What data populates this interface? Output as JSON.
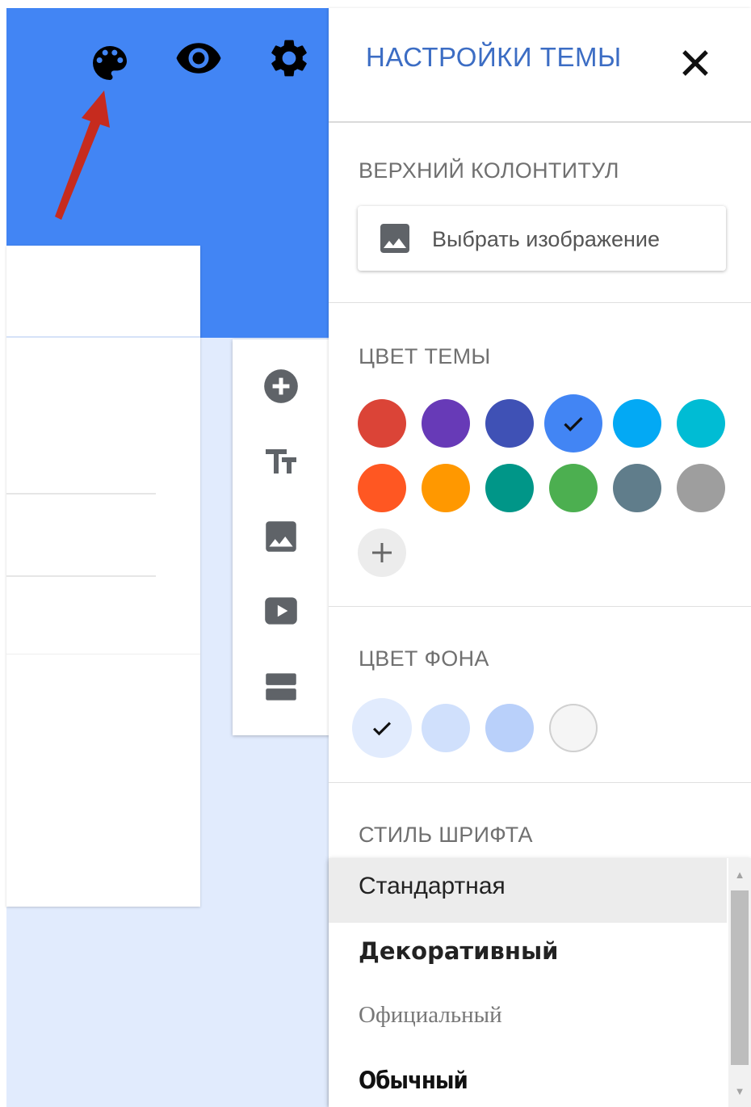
{
  "header": {
    "icons": [
      "palette-icon",
      "eye-icon",
      "gear-icon"
    ],
    "color": "#4285f4"
  },
  "toolbar": {
    "icons": [
      "add-circle-icon",
      "text-title-icon",
      "image-icon",
      "video-icon",
      "section-icon"
    ]
  },
  "panel": {
    "title": "НАСТРОЙКИ ТЕМЫ",
    "header_section": {
      "label": "ВЕРХНИЙ КОЛОНТИТУЛ",
      "button_label": "Выбрать изображение"
    },
    "theme_color": {
      "label": "ЦВЕТ ТЕМЫ",
      "colors": [
        "#db4437",
        "#673ab7",
        "#3f51b5",
        "#4285f4",
        "#03a9f4",
        "#00bcd4",
        "#ff5722",
        "#ff9800",
        "#009688",
        "#4caf50",
        "#607d8b",
        "#9e9e9e"
      ],
      "selected": "#4285f4"
    },
    "background_color": {
      "label": "ЦВЕТ ФОНА",
      "colors": [
        "#e1ebfd",
        "#d0e0fc",
        "#b9d0fa",
        "#f5f5f5"
      ],
      "selected": "#e1ebfd"
    },
    "font_style": {
      "label": "СТИЛЬ ШРИФТА",
      "options": [
        "Стандартная",
        "Декоративный",
        "Официальный",
        "Обычный"
      ],
      "highlighted": "Стандартная"
    }
  }
}
